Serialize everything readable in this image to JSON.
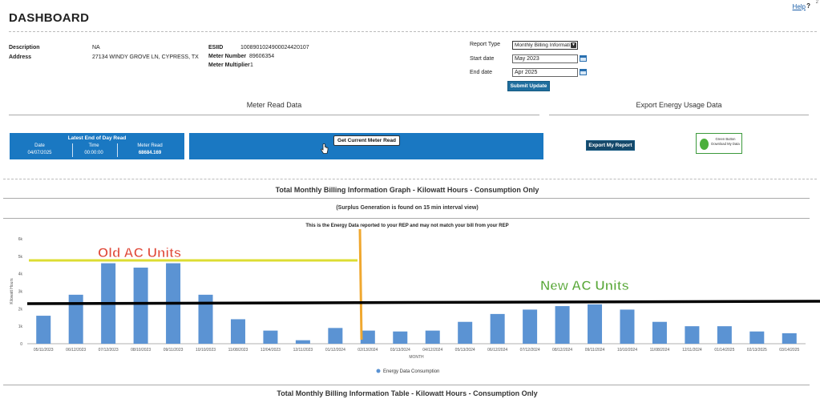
{
  "header": {
    "title": "DASHBOARD",
    "help_label": "Help",
    "help_q": "?",
    "corner_mark": "2"
  },
  "info": {
    "description_label": "Description",
    "description_value": "NA",
    "address_label": "Address",
    "address_value": "27134 WINDY GROVE LN, CYPRESS, TX",
    "esiid_label": "ESIID",
    "esiid_value": "1008901024900024420107",
    "meter_number_label": "Meter Number",
    "meter_number_value": "89606354",
    "meter_multiplier_label": "Meter Multiplier",
    "meter_multiplier_value": "1"
  },
  "report": {
    "report_type_label": "Report Type",
    "report_type_value": "Monthly Billing Informati",
    "start_date_label": "Start date",
    "start_date_value": "May 2023",
    "end_date_label": "End date",
    "end_date_value": "Apr 2025",
    "submit_label": "Submit Update"
  },
  "meter_read": {
    "section_title": "Meter Read Data",
    "panel_title": "Latest End of Day Read",
    "date_label": "Date",
    "date_value": "04/07/2025",
    "time_label": "Time",
    "time_value": "00:00:00",
    "meter_read_label": "Meter Read",
    "meter_read_value": "68684.169",
    "get_current_label": "Get Current Meter Read"
  },
  "export": {
    "section_title": "Export Energy Usage Data",
    "export_button_label": "Export My Report",
    "green_button_line1": "Green Button",
    "green_button_line2": "Download My Data"
  },
  "graph_section": {
    "title": "Total Monthly Billing Information Graph - Kilowatt Hours - Consumption Only",
    "subtitle": "(Surplus Generation is found on 15 min interval view)",
    "notice": "This is the Energy Data reported to your REP and may not match your bill from your REP"
  },
  "annotations": {
    "old_units": "Old AC Units",
    "new_units": "New AC Units"
  },
  "table_section": {
    "title": "Total Monthly Billing Information Table - Kilowatt Hours - Consumption Only"
  },
  "colors": {
    "bar": "#5b93d3",
    "panel_blue": "#1a78c2",
    "button_blue": "#1f6e9e",
    "annotation_yellow": "#dddd33",
    "annotation_orange": "#f0a830",
    "annotation_black": "#000000",
    "annotation_text_red": "#e04a3a",
    "annotation_text_green": "#5aa83a"
  },
  "chart_data": {
    "type": "bar",
    "ylabel": "Kilowatt Hours",
    "xlabel": "MONTH",
    "ylim": [
      0,
      6000
    ],
    "yticks": [
      "0",
      "1k",
      "2k",
      "3k",
      "4k",
      "5k",
      "6k"
    ],
    "legend_position": "bottom",
    "categories": [
      "05/11/2023",
      "06/12/2023",
      "07/12/2023",
      "08/10/2023",
      "09/11/2023",
      "10/10/2023",
      "11/08/2023",
      "12/04/2023",
      "12/11/2023",
      "01/12/2024",
      "02/13/2024",
      "03/13/2024",
      "04/12/2024",
      "05/13/2024",
      "06/12/2024",
      "07/12/2024",
      "08/12/2024",
      "09/11/2024",
      "10/10/2024",
      "11/08/2024",
      "12/11/2024",
      "01/14/2025",
      "02/13/2025",
      "03/14/2025"
    ],
    "series": [
      {
        "name": "Energy Data Consumption",
        "values": [
          1600,
          2800,
          4600,
          4350,
          4600,
          2800,
          1400,
          750,
          200,
          900,
          750,
          700,
          750,
          1250,
          1700,
          1950,
          2150,
          2250,
          1950,
          1250,
          1000,
          1000,
          700,
          600
        ]
      }
    ]
  }
}
